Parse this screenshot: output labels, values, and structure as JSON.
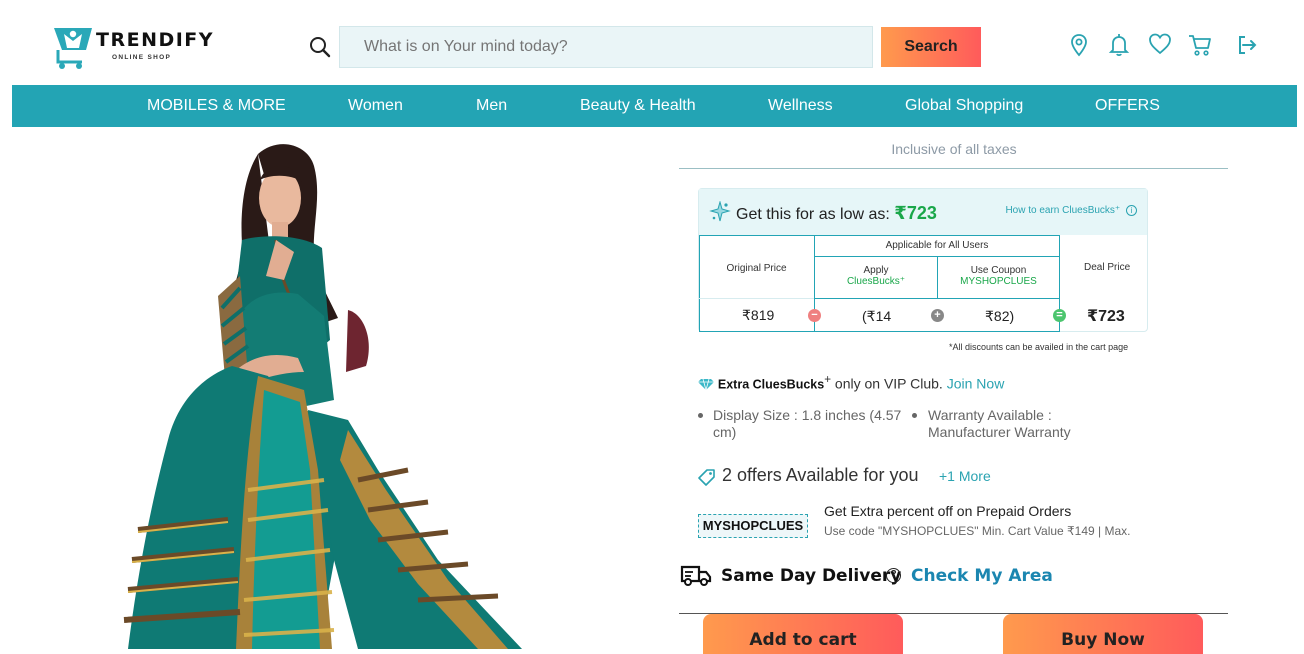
{
  "brand": {
    "name": "TRENDIFY",
    "tagline": "ONLINE SHOP"
  },
  "search": {
    "placeholder": "What is on Your mind today?",
    "button": "Search"
  },
  "header_icons": [
    "location-icon",
    "bell-icon",
    "heart-icon",
    "cart-icon",
    "logout-icon"
  ],
  "nav": [
    "MOBILES & MORE",
    "Women",
    "Men",
    "Beauty & Health",
    "Wellness",
    "Global Shopping",
    "OFFERS"
  ],
  "product": {
    "taxes_note": "Inclusive of all taxes",
    "low_price_label": "Get this for as low as:",
    "low_price": "₹723",
    "earn_link": "How to earn CluesBucks⁺",
    "table": {
      "original_label": "Original Price",
      "applicable_label": "Applicable for All Users",
      "apply_label": "Apply",
      "apply_sub": "CluesBucks⁺",
      "coupon_label": "Use Coupon",
      "coupon_code": "MYSHOPCLUES",
      "deal_label": "Deal Price",
      "original_value": "₹819",
      "cluesbucks_value": "(₹14",
      "coupon_value": "₹82)",
      "deal_value": "₹723"
    },
    "discount_note": "*All discounts can be availed in the cart page",
    "vip": {
      "bold": "Extra CluesBucks",
      "sup": "+",
      "text": " only on VIP Club. ",
      "link": "Join Now"
    },
    "features": [
      "Display Size : 1.8 inches (4.57 cm)",
      "Warranty Available : Manufacturer Warranty"
    ],
    "offers_title": "2 offers Available for you",
    "offers_more": "+1 More",
    "offer": {
      "code": "MYSHOPCLUES",
      "title": "Get Extra percent off on Prepaid Orders",
      "desc": "Use code \"MYSHOPCLUES\" Min. Cart Value ₹149 | Max."
    },
    "delivery_label": "Same Day Delivery",
    "check_area": "Check My Area",
    "add_to_cart": "Add to cart",
    "buy_now": "Buy Now"
  },
  "colors": {
    "accent": "#23a4b4",
    "green": "#1aa74a",
    "button_from": "#ff9a4d",
    "button_to": "#ff5b5b"
  }
}
